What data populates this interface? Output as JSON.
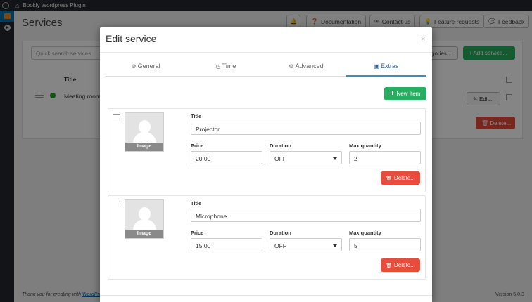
{
  "admin_bar": {
    "site_name": "Bookly Wordpress Plugin"
  },
  "page": {
    "title": "Services",
    "top_buttons": [
      {
        "icon": "bell-icon",
        "label": ""
      },
      {
        "icon": "question-icon",
        "label": "Documentation"
      },
      {
        "icon": "envelope-icon",
        "label": "Contact us"
      },
      {
        "icon": "lightbulb-icon",
        "label": "Feature requests"
      },
      {
        "icon": "comment-icon",
        "label": "Feedback"
      }
    ],
    "search_placeholder": "Quick search services",
    "categories_label": "gories...",
    "add_service_label": "+ Add service...",
    "table": {
      "header_title": "Title",
      "rows": [
        {
          "title": "Meeting room",
          "edit_label": "Edit...",
          "color": "#1ea21e"
        }
      ]
    },
    "delete_label": "Delete...",
    "footer_thanks": "Thank you for creating with ",
    "footer_link": "WordPre",
    "version": "Version 5.0.3"
  },
  "modal": {
    "title": "Edit service",
    "close": "×",
    "tabs": [
      {
        "icon": "gear-icon",
        "glyph": "⚙",
        "label": "General",
        "active": false
      },
      {
        "icon": "clock-icon",
        "glyph": "◷",
        "label": "Time",
        "active": false
      },
      {
        "icon": "gears-icon",
        "glyph": "⚙",
        "label": "Advanced",
        "active": false
      },
      {
        "icon": "briefcase-icon",
        "glyph": "▣",
        "label": "Extras",
        "active": true
      }
    ],
    "new_item_label": "New Item",
    "labels": {
      "title": "Title",
      "price": "Price",
      "duration": "Duration",
      "max_quantity": "Max quantity",
      "image": "Image",
      "delete": "Delete..."
    },
    "extras": [
      {
        "title": "Projector",
        "price": "20.00",
        "duration": "OFF",
        "max_quantity": "2"
      },
      {
        "title": "Microphone",
        "price": "15.00",
        "duration": "OFF",
        "max_quantity": "5"
      }
    ]
  },
  "colors": {
    "accent_green": "#27ae60",
    "danger_red": "#e74c3c",
    "tab_active": "#3c8dbc",
    "wp_dark": "#23282d"
  }
}
